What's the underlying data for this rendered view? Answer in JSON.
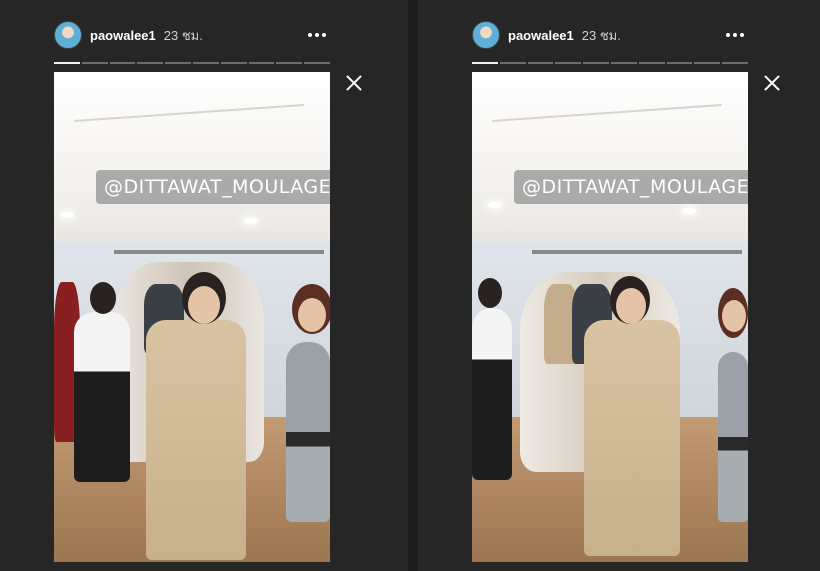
{
  "stories": [
    {
      "username": "paowalee1",
      "time": "23 ชม.",
      "tag": "@DITTAWAT_MOULAGE",
      "avatar_icon": "avatar",
      "more_icon": "more-options-icon",
      "close_icon": "close-icon",
      "progress": {
        "total": 10,
        "current": 1
      }
    },
    {
      "username": "paowalee1",
      "time": "23 ชม.",
      "tag": "@DITTAWAT_MOULAGE",
      "avatar_icon": "avatar",
      "more_icon": "more-options-icon",
      "close_icon": "close-icon",
      "progress": {
        "total": 10,
        "current": 1
      }
    }
  ],
  "colors": {
    "background": "#262626",
    "text": "#ffffff",
    "progress_inactive": "#6d6d6d",
    "progress_active": "#f2f2f2"
  }
}
